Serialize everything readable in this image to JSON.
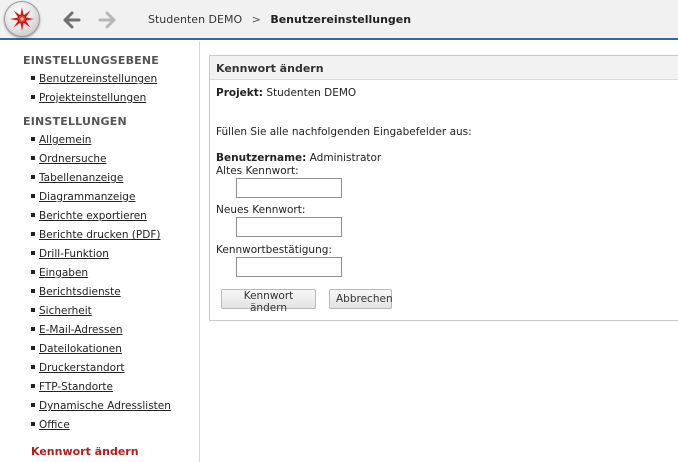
{
  "header": {
    "logo": "starburst-logo",
    "back_icon": "arrow-left-icon",
    "forward_icon": "arrow-right-icon",
    "breadcrumb": {
      "parent": "Studenten DEMO",
      "separator": ">",
      "current": "Benutzereinstellungen"
    },
    "accent_color": "#2a6d9a"
  },
  "sidebar": {
    "section1_title": "EINSTELLUNGSEBENE",
    "section1_items": [
      "Benutzereinstellungen",
      "Projekteinstellungen"
    ],
    "section2_title": "EINSTELLUNGEN",
    "section2_items": [
      "Allgemein",
      "Ordnersuche",
      "Tabellenanzeige",
      "Diagrammanzeige",
      "Berichte exportieren",
      "Berichte drucken (PDF)",
      "Drill-Funktion",
      "Eingaben",
      "Berichtsdienste",
      "Sicherheit",
      "E-Mail-Adressen",
      "Dateilokationen",
      "Druckerstandort",
      "FTP-Standorte",
      "Dynamische Adresslisten",
      "Office"
    ],
    "active_item": "Kennwort ändern",
    "active_color": "#b51c1c"
  },
  "panel": {
    "title": "Kennwort ändern",
    "project_label": "Projekt:",
    "project_value": "Studenten DEMO",
    "instruction": "Füllen Sie alle nachfolgenden Eingabefelder aus:",
    "username_label": "Benutzername:",
    "username_value": "Administrator",
    "old_password_label": "Altes Kennwort:",
    "old_password_value": "",
    "new_password_label": "Neues Kennwort:",
    "new_password_value": "",
    "confirm_label": "Kennwortbestätigung:",
    "confirm_value": "",
    "change_button": "Kennwort ändern",
    "cancel_button": "Abbrechen"
  }
}
